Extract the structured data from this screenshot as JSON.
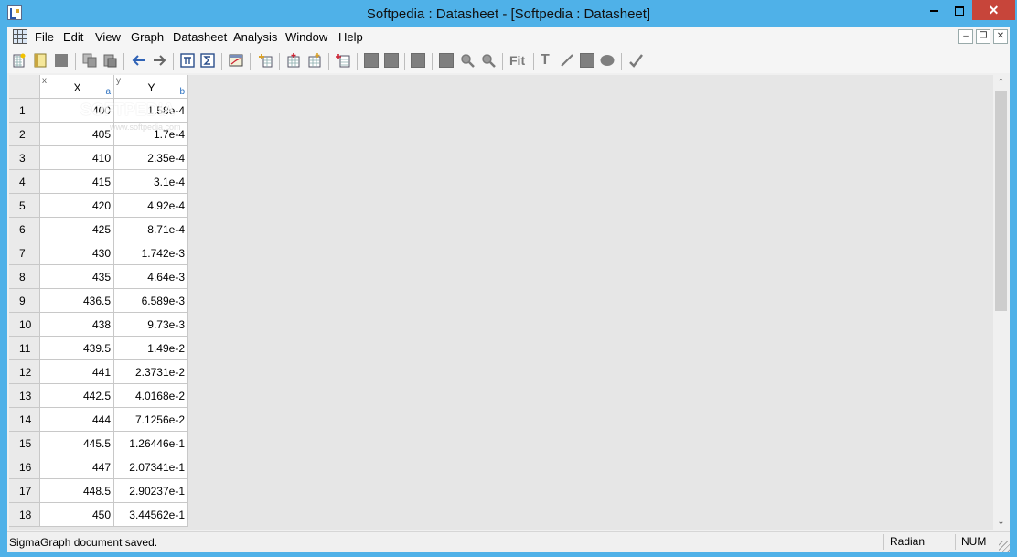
{
  "window": {
    "title": "Softpedia : Datasheet - [Softpedia : Datasheet]"
  },
  "menubar": {
    "items": [
      "File",
      "Edit",
      "View",
      "Graph",
      "Datasheet",
      "Analysis",
      "Window",
      "Help"
    ]
  },
  "sheet": {
    "columns": [
      {
        "tag": "x",
        "name": "X",
        "plot": "a"
      },
      {
        "tag": "y",
        "name": "Y",
        "plot": "b"
      }
    ],
    "rows": [
      {
        "n": "1",
        "x": "400",
        "y": "1.58e-4"
      },
      {
        "n": "2",
        "x": "405",
        "y": "1.7e-4"
      },
      {
        "n": "3",
        "x": "410",
        "y": "2.35e-4"
      },
      {
        "n": "4",
        "x": "415",
        "y": "3.1e-4"
      },
      {
        "n": "5",
        "x": "420",
        "y": "4.92e-4"
      },
      {
        "n": "6",
        "x": "425",
        "y": "8.71e-4"
      },
      {
        "n": "7",
        "x": "430",
        "y": "1.742e-3"
      },
      {
        "n": "8",
        "x": "435",
        "y": "4.64e-3"
      },
      {
        "n": "9",
        "x": "436.5",
        "y": "6.589e-3"
      },
      {
        "n": "10",
        "x": "438",
        "y": "9.73e-3"
      },
      {
        "n": "11",
        "x": "439.5",
        "y": "1.49e-2"
      },
      {
        "n": "12",
        "x": "441",
        "y": "2.3731e-2"
      },
      {
        "n": "13",
        "x": "442.5",
        "y": "4.0168e-2"
      },
      {
        "n": "14",
        "x": "444",
        "y": "7.1256e-2"
      },
      {
        "n": "15",
        "x": "445.5",
        "y": "1.26446e-1"
      },
      {
        "n": "16",
        "x": "447",
        "y": "2.07341e-1"
      },
      {
        "n": "17",
        "x": "448.5",
        "y": "2.90237e-1"
      },
      {
        "n": "18",
        "x": "450",
        "y": "3.44562e-1"
      }
    ],
    "watermark": "SOFTPEDIA",
    "watermark_url": "www.softpedia.com"
  },
  "statusbar": {
    "message": "SigmaGraph document saved.",
    "angle_mode": "Radian",
    "num_lock": "NUM"
  },
  "toolbar": {
    "fit_label": "Fit",
    "text_tool_label": "T"
  },
  "icons": {
    "undo": "arrow-left-icon",
    "redo": "arrow-right-icon",
    "zoom_in": "zoom-in-icon",
    "zoom_out": "zoom-out-icon"
  },
  "colors": {
    "titlebar": "#4fb1e8",
    "close_button": "#c7453a",
    "mdi_background": "#e6e6e6"
  }
}
